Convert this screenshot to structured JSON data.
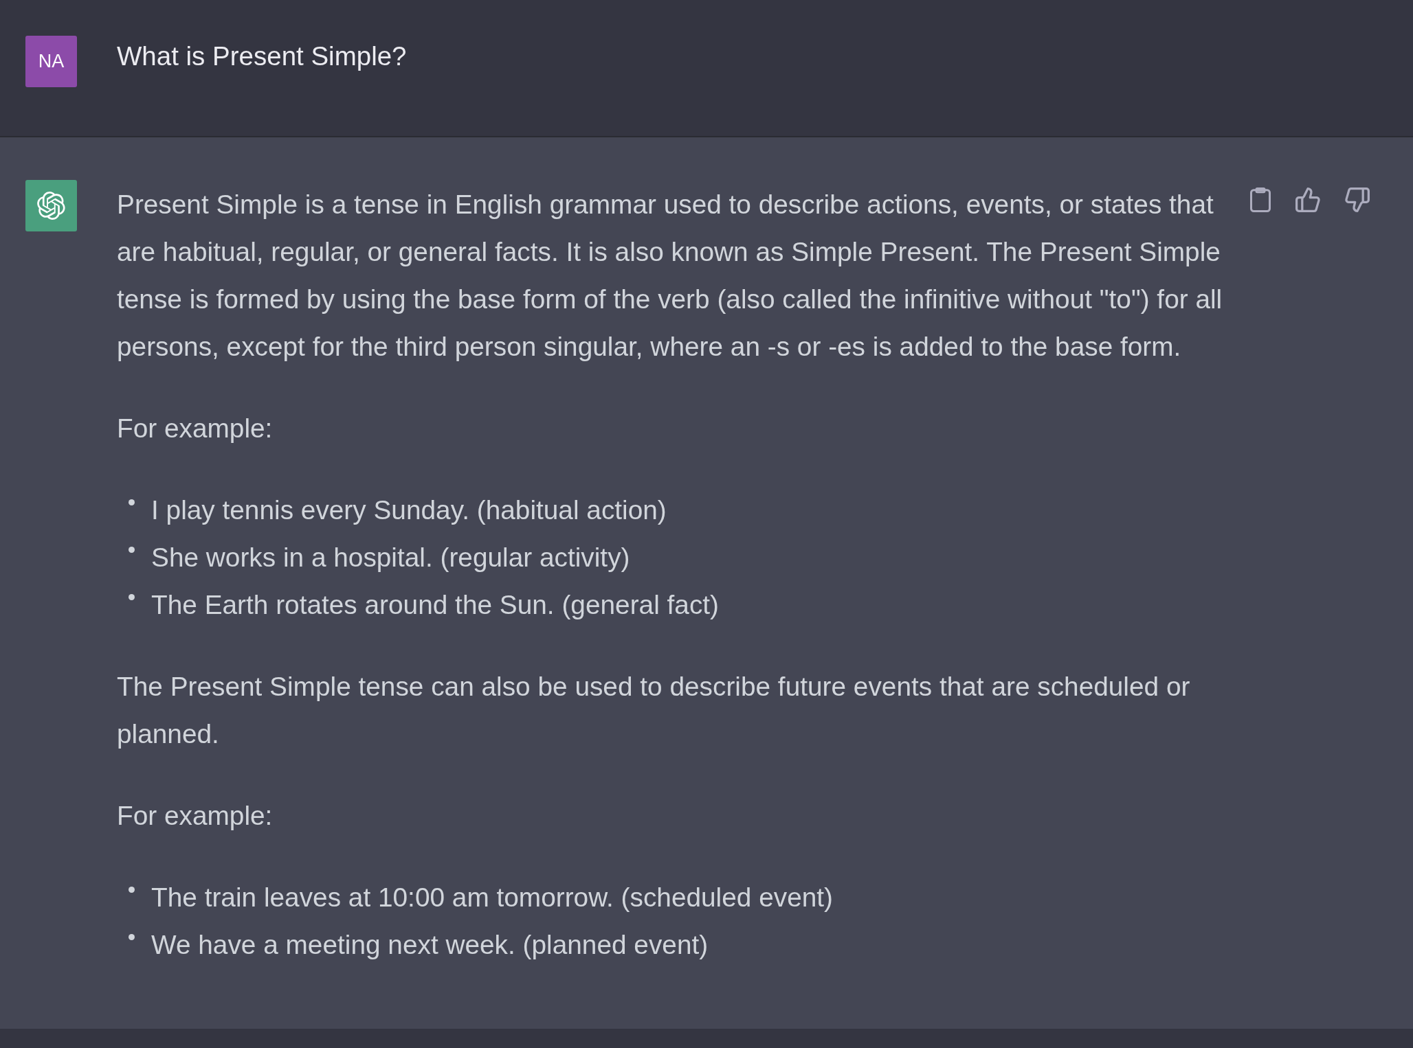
{
  "user_message": {
    "avatar": "NA",
    "text": "What is Present Simple?"
  },
  "assistant_message": {
    "blocks": [
      {
        "kind": "paragraph",
        "text": "Present Simple is a tense in English grammar used to describe actions, events, or states that are habitual, regular, or general facts. It is also known as Simple Present. The Present Simple tense is formed by using the base form of the verb (also called the infinitive without \"to\") for all persons, except for the third person singular, where an -s or -es is added to the base form."
      },
      {
        "kind": "paragraph",
        "text": "For example:"
      },
      {
        "kind": "list",
        "items": [
          "I play tennis every Sunday. (habitual action)",
          "She works in a hospital. (regular activity)",
          "The Earth rotates around the Sun. (general fact)"
        ]
      },
      {
        "kind": "paragraph",
        "text": "The Present Simple tense can also be used to describe future events that are scheduled or planned."
      },
      {
        "kind": "paragraph",
        "text": "For example:"
      },
      {
        "kind": "list",
        "items": [
          "The train leaves at 10:00 am tomorrow. (scheduled event)",
          "We have a meeting next week. (planned event)"
        ]
      }
    ]
  }
}
